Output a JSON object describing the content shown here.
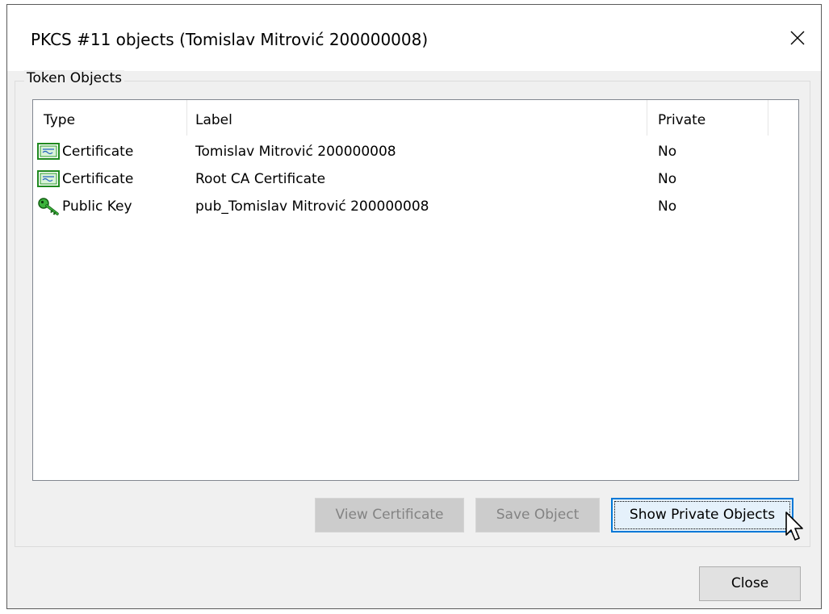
{
  "window": {
    "title": "PKCS #11 objects (Tomislav Mitrović 200000008)",
    "close_glyph": "✕"
  },
  "group": {
    "label": "Token Objects"
  },
  "table": {
    "columns": [
      "Type",
      "Label",
      "Private"
    ],
    "rows": [
      {
        "icon": "certificate-icon",
        "type": "Certificate",
        "label": "Tomislav Mitrović 200000008",
        "private": "No"
      },
      {
        "icon": "certificate-icon",
        "type": "Certificate",
        "label": "Root CA Certificate",
        "private": "No"
      },
      {
        "icon": "key-icon",
        "type": "Public Key",
        "label": "pub_Tomislav Mitrović 200000008",
        "private": "No"
      }
    ]
  },
  "buttons": {
    "view_certificate": "View Certificate",
    "save_object": "Save Object",
    "show_private_objects": "Show Private Objects",
    "close": "Close"
  },
  "colors": {
    "focus_border": "#0078d7",
    "disabled_bg": "#cccccc",
    "dialog_bg": "#f0f0f0",
    "icon_green": "#2e9e2e"
  }
}
